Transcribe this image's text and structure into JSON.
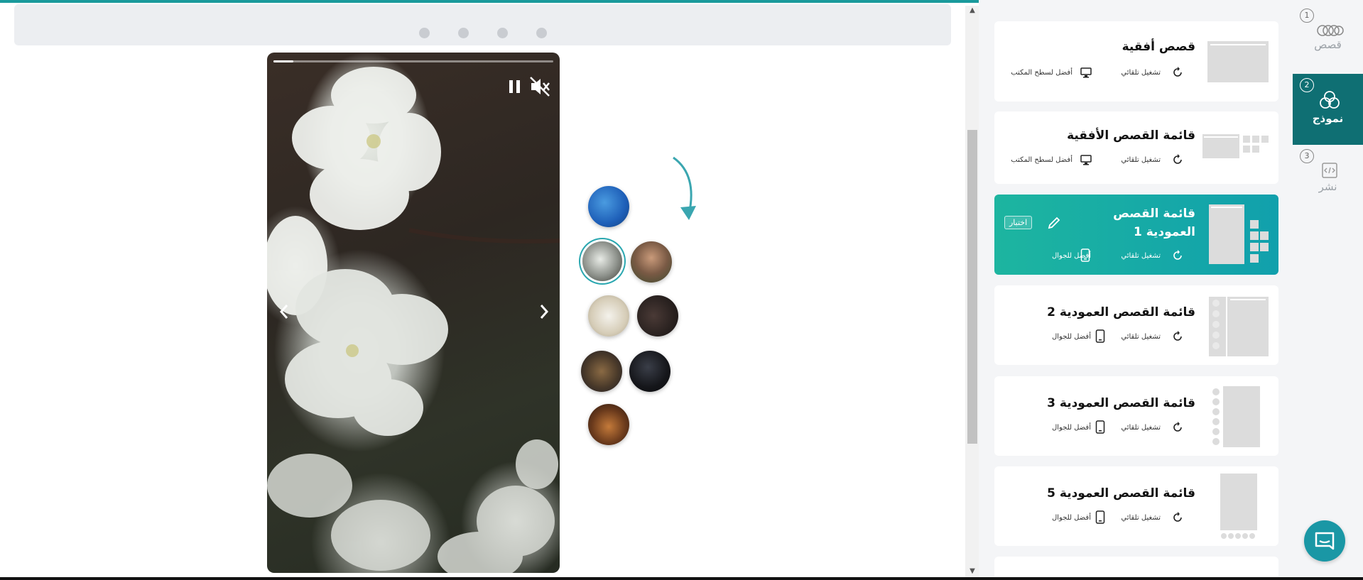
{
  "dots_count": 4,
  "player": {
    "progress": 0.07,
    "pause_icon": "pause-icon",
    "mute_icon": "volume-mute-icon",
    "prev_icon": "chevron-left-icon",
    "next_icon": "chevron-right-icon"
  },
  "templates": {
    "items": [
      {
        "title": "قصص أفقية",
        "autoplay": "تشغيل تلقائي",
        "best_for": "أفضل لسطح المكتب",
        "device_icon": "desktop-icon"
      },
      {
        "title": "قائمة القصص الأفقية",
        "autoplay": "تشغيل تلقائي",
        "best_for": "أفضل لسطح المكتب",
        "device_icon": "desktop-icon"
      },
      {
        "title": "قائمة القصص العمودية 1",
        "autoplay": "تشغيل تلقائي",
        "best_for": "أفضل للجوال",
        "device_icon": "mobile-icon",
        "try_label": "اختبار"
      },
      {
        "title": "قائمة القصص العمودية 2",
        "autoplay": "تشغيل تلقائي",
        "best_for": "أفضل للجوال",
        "device_icon": "mobile-icon"
      },
      {
        "title": "قائمة القصص العمودية 3",
        "autoplay": "تشغيل تلقائي",
        "best_for": "أفضل للجوال",
        "device_icon": "mobile-icon"
      },
      {
        "title": "قائمة القصص العمودية 5",
        "autoplay": "تشغيل تلقائي",
        "best_for": "أفضل للجوال",
        "device_icon": "mobile-icon"
      }
    ]
  },
  "steps": [
    {
      "number": "1",
      "label": "قصص",
      "icon": "stories-icon"
    },
    {
      "number": "2",
      "label": "نموذج",
      "icon": "template-icon"
    },
    {
      "number": "3",
      "label": "نشر",
      "icon": "code-publish-icon"
    }
  ],
  "colors": {
    "accent": "#1a9a9c",
    "active_card_start": "#1db5a0",
    "active_card_end": "#11a0ac",
    "active_step": "#0f6f73"
  }
}
